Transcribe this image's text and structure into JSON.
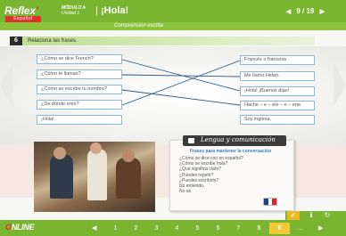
{
  "header": {
    "logo": "Reflex",
    "logo_dot": "'",
    "logo_sub": "Español",
    "module_line1": "MÓDULO A",
    "module_line2": "Unidad 1",
    "title": "¡Hola!",
    "page": "9 / 19"
  },
  "subheader": {
    "title": "Comprensión escrita"
  },
  "exercise": {
    "number": "6",
    "instruction": "Relaciona las frases.",
    "questions": [
      "¿Cómo se dice French?",
      "¿Cómo te llamas?",
      "¿Cómo se escribe tu nombre?",
      "¿De dónde eres?",
      "¡Hola!"
    ],
    "answers": [
      "Francés o francesa",
      "Me llamo Helen.",
      "¡Hola! ¡Buenos días!",
      "Hache – e – ele – e – ene.",
      "Soy inglesa."
    ]
  },
  "panel": {
    "title": "Lengua y comunicación",
    "subtitle": "Frases para mantener la conversación",
    "items": [
      "¿Cómo se dice coo en español?",
      "¿Cómo se escribe hola?",
      "¿Qué significa claro?",
      "¿Puedes repetir?",
      "¿Puedes escribirlo?",
      "No entiendo.",
      "No sé."
    ]
  },
  "footer": {
    "brand_o": "O",
    "brand": "NLINE",
    "pages": [
      "1",
      "2",
      "3",
      "4",
      "5",
      "6",
      "7",
      "8",
      "9",
      "..."
    ],
    "current_page": "9"
  },
  "colors": {
    "brand_green": "#7ab532",
    "accent_red": "#e0332d",
    "highlight_yellow": "#f0c838"
  },
  "icons": [
    "prev-arrow-icon",
    "next-arrow-icon",
    "check-icon",
    "info-icon",
    "refresh-icon",
    "plug-icon",
    "flag-fr-icon"
  ]
}
